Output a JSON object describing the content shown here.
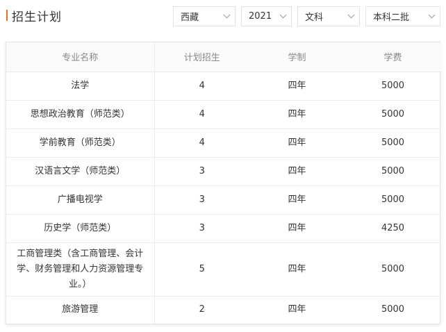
{
  "header": {
    "title": "招生计划"
  },
  "filters": {
    "province": "西藏",
    "year": "2021",
    "subject": "文科",
    "batch": "本科二批"
  },
  "table": {
    "columns": [
      "专业名称",
      "计划招生",
      "学制",
      "学费"
    ],
    "rows": [
      {
        "major": "法学",
        "plan": "4",
        "duration": "四年",
        "fee": "5000"
      },
      {
        "major": "思想政治教育（师范类）",
        "plan": "4",
        "duration": "四年",
        "fee": "5000"
      },
      {
        "major": "学前教育（师范类）",
        "plan": "4",
        "duration": "四年",
        "fee": "5000"
      },
      {
        "major": "汉语言文学（师范类）",
        "plan": "3",
        "duration": "四年",
        "fee": "5000"
      },
      {
        "major": "广播电视学",
        "plan": "3",
        "duration": "四年",
        "fee": "5000"
      },
      {
        "major": "历史学（师范类）",
        "plan": "3",
        "duration": "四年",
        "fee": "4250"
      },
      {
        "major": "工商管理类（含工商管理、会计学、财务管理和人力资源管理专业。）",
        "plan": "5",
        "duration": "四年",
        "fee": "5000"
      },
      {
        "major": "旅游管理",
        "plan": "2",
        "duration": "四年",
        "fee": "5000"
      }
    ]
  },
  "colors": {
    "accent": "#f07020"
  }
}
